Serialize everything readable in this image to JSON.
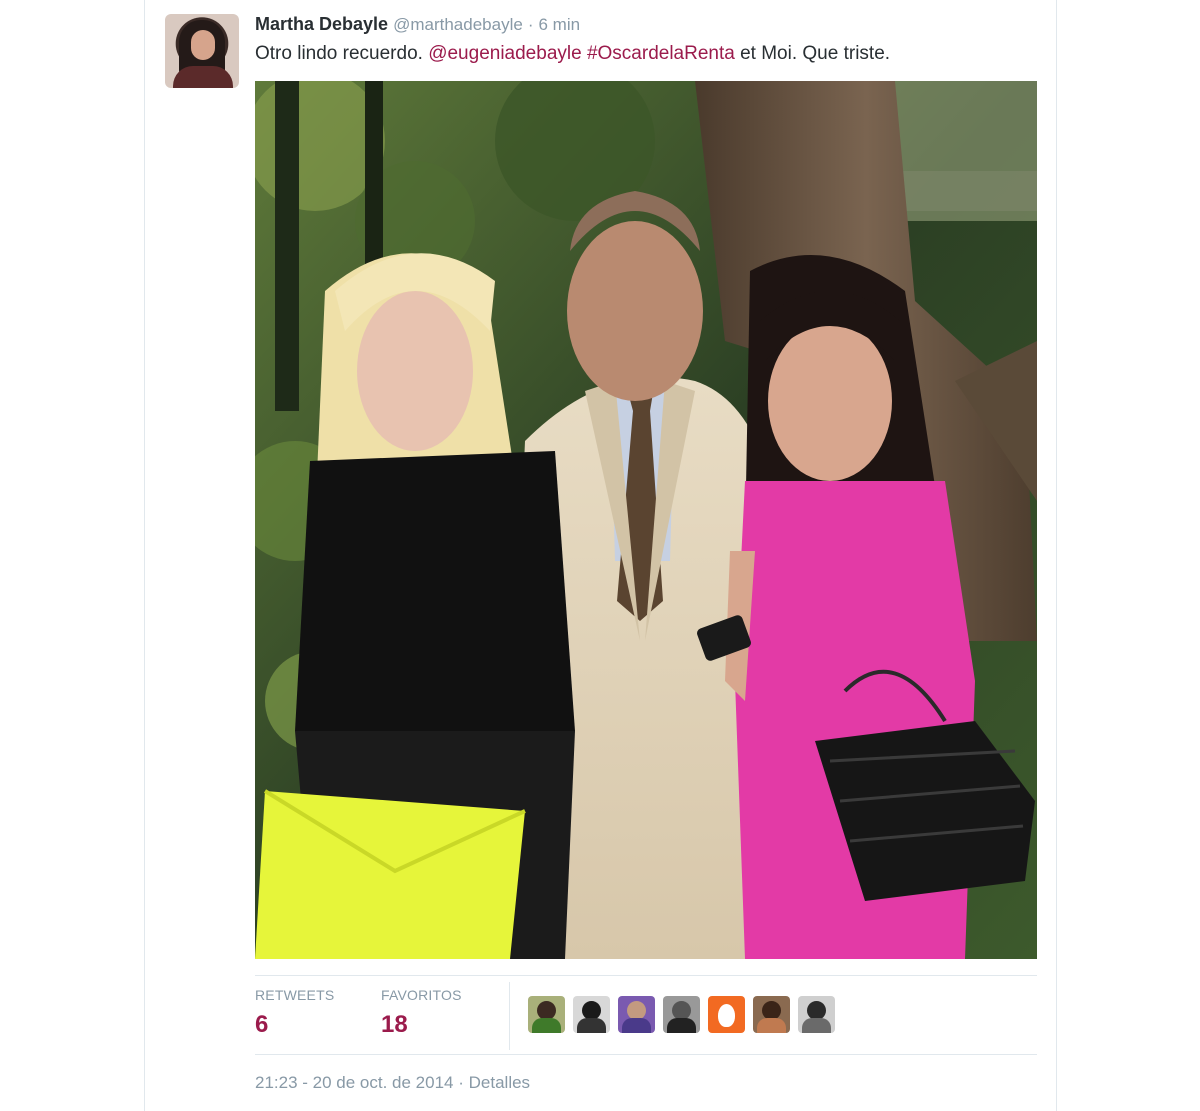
{
  "tweet": {
    "author_name": "Martha Debayle",
    "author_handle": "@marthadebayle",
    "separator": "·",
    "time_ago": "6 min",
    "text_start": "Otro lindo recuerdo. ",
    "mention": "@eugeniadebayle",
    "text_space": " ",
    "hashtag": "#OscardelaRenta",
    "text_end": " et Moi. Que triste.",
    "link_color": "#9b1b4c"
  },
  "stats": {
    "retweets_label": "RETWEETS",
    "retweets_value": "6",
    "favorites_label": "FAVORITOS",
    "favorites_value": "18"
  },
  "favoriters": [
    {
      "icon": "avatar-green-shirt"
    },
    {
      "icon": "avatar-dark-hair"
    },
    {
      "icon": "avatar-purple"
    },
    {
      "icon": "avatar-gray"
    },
    {
      "icon": "avatar-orange-logo"
    },
    {
      "icon": "avatar-brown"
    },
    {
      "icon": "avatar-bw"
    }
  ],
  "footer": {
    "timestamp": "21:23 - 20 de oct. de 2014",
    "separator": "·",
    "details_link": "Detalles"
  }
}
